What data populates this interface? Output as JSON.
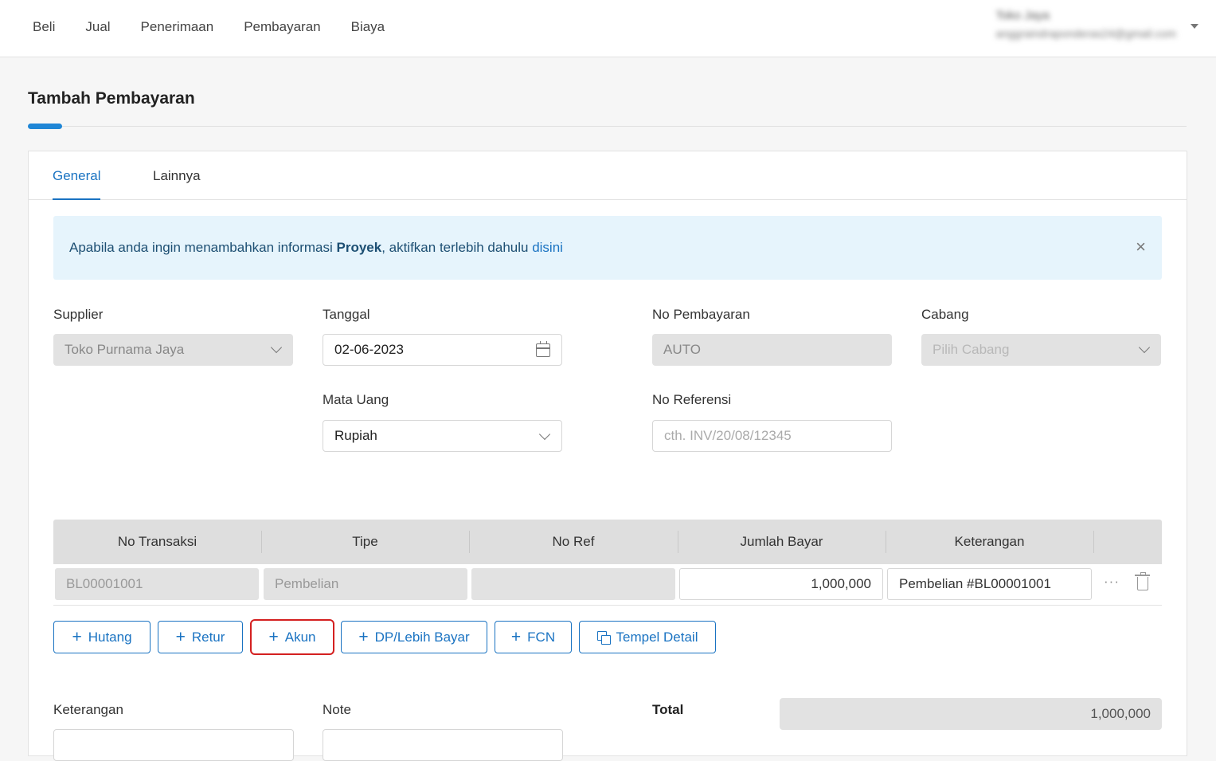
{
  "nav": {
    "items": [
      "Beli",
      "Jual",
      "Penerimaan",
      "Pembayaran",
      "Biaya"
    ]
  },
  "user": {
    "name": "Toko Jaya",
    "email": "anggraindraponderas24@gmail.com"
  },
  "page": {
    "title": "Tambah Pembayaran"
  },
  "tabs": [
    "General",
    "Lainnya"
  ],
  "info": {
    "text_before": "Apabila anda ingin menambahkan informasi ",
    "bold": "Proyek",
    "text_after": ", aktifkan terlebih dahulu ",
    "link": "disini",
    "close": "×"
  },
  "form": {
    "supplier": {
      "label": "Supplier",
      "value": "Toko Purnama Jaya"
    },
    "tanggal": {
      "label": "Tanggal",
      "value": "02-06-2023"
    },
    "no_pembayaran": {
      "label": "No Pembayaran",
      "value": "AUTO"
    },
    "cabang": {
      "label": "Cabang",
      "placeholder": "Pilih Cabang"
    },
    "mata_uang": {
      "label": "Mata Uang",
      "value": "Rupiah"
    },
    "no_referensi": {
      "label": "No Referensi",
      "placeholder": "cth. INV/20/08/12345"
    }
  },
  "table": {
    "headers": [
      "No Transaksi",
      "Tipe",
      "No Ref",
      "Jumlah Bayar",
      "Keterangan"
    ],
    "rows": [
      {
        "no_transaksi": "BL00001001",
        "tipe": "Pembelian",
        "no_ref": "",
        "jumlah_bayar": "1,000,000",
        "keterangan": "Pembelian #BL00001001",
        "more": "···"
      }
    ]
  },
  "buttons": {
    "hutang": "Hutang",
    "retur": "Retur",
    "akun": "Akun",
    "dp": "DP/Lebih Bayar",
    "fcn": "FCN",
    "tempel": "Tempel Detail",
    "plus": "+"
  },
  "footer": {
    "keterangan_label": "Keterangan",
    "note_label": "Note",
    "total_label": "Total",
    "total_value": "1,000,000"
  },
  "colors": {
    "accent": "#1a73c2",
    "highlight": "#d42020",
    "info_bg": "#e6f4fc"
  }
}
